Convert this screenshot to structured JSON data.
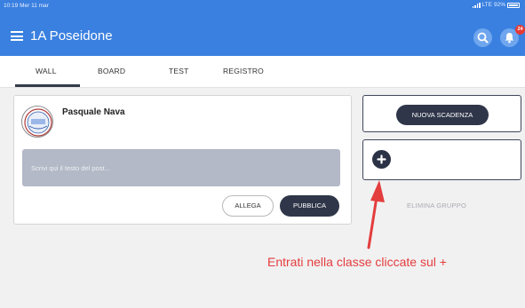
{
  "status_bar": {
    "time": "10:19",
    "date": "Mer 11 mar",
    "network": "LTE",
    "battery": "92%"
  },
  "header": {
    "title": "1A Poseidone",
    "notification_count": "24",
    "color": "#3a80e0"
  },
  "tabs": [
    {
      "label": "WALL",
      "active": true
    },
    {
      "label": "BOARD",
      "active": false
    },
    {
      "label": "TEST",
      "active": false
    },
    {
      "label": "REGISTRO",
      "active": false
    }
  ],
  "post": {
    "author": "Pasquale Nava",
    "placeholder": "Scrivi qui il testo del post...",
    "attach_label": "ALLEGA",
    "publish_label": "PUBBLICA"
  },
  "sidebar": {
    "new_deadline_label": "NUOVA SCADENZA",
    "delete_group_label": "ELIMINA GRUPPO"
  },
  "annotation": {
    "text": "Entrati nella classe cliccate sul +",
    "color": "#e43d3d"
  },
  "icons": [
    "menu-icon",
    "search-icon",
    "bell-icon",
    "plus-icon",
    "avatar-logo"
  ]
}
